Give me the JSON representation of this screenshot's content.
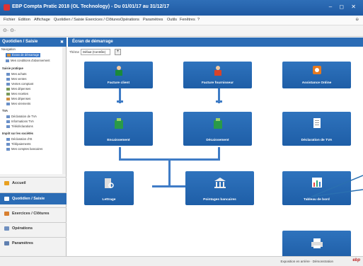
{
  "window": {
    "title": "EBP Compta Pratic 2018 (OL Technology) - Du 01/01/17 au 31/12/17",
    "controls": "– ◻ ✕"
  },
  "menu": {
    "items": [
      "Fichier",
      "Edition",
      "Affichage",
      "Quotidien / Saisie",
      "Exercices / Clôtures",
      "Opérations",
      "Paramètres",
      "Outils",
      "Fenêtres",
      "?"
    ],
    "help": "⊝"
  },
  "toolbar": {
    "nav": "⊙· ⊙·"
  },
  "left_panel": {
    "header": "Quotidien / Saisie",
    "close": "✖",
    "tree": [
      {
        "label": "Navigation",
        "type": "root"
      },
      {
        "label": "Écran de démarrage",
        "type": "selected"
      },
      {
        "label": "Mes conditions d'abonnement",
        "type": "item"
      },
      {
        "label": "Saisie pratique",
        "type": "group"
      },
      {
        "label": "Mes achats",
        "type": "item"
      },
      {
        "label": "Mes ventes",
        "type": "item"
      },
      {
        "label": "Ventes comptant",
        "type": "item"
      },
      {
        "label": "Mes dépenses",
        "type": "item"
      },
      {
        "label": "Mes recettes",
        "type": "item"
      },
      {
        "label": "Mes dépenses",
        "type": "item"
      },
      {
        "label": "Mes virements",
        "type": "item"
      },
      {
        "label": "TVA",
        "type": "group"
      },
      {
        "label": "Déclaration de TVA",
        "type": "item"
      },
      {
        "label": "Informations TVA",
        "type": "item"
      },
      {
        "label": "Télédéclarations",
        "type": "item"
      },
      {
        "label": "Impôt sur les sociétés",
        "type": "group"
      },
      {
        "label": "Déclaration d'IS",
        "type": "item"
      },
      {
        "label": "Télépaiements",
        "type": "item"
      },
      {
        "label": "Mes comptes bancaires",
        "type": "item"
      }
    ]
  },
  "bottom_nav": [
    {
      "label": "Accueil",
      "active": false,
      "color": "#e8a020"
    },
    {
      "label": "Quotidien / Saisie",
      "active": true,
      "color": "#ffffff"
    },
    {
      "label": "Exercices / Clôtures",
      "active": false,
      "color": "#d88030"
    },
    {
      "label": "Opérations",
      "active": false,
      "color": "#7090c0"
    },
    {
      "label": "Paramètres",
      "active": false,
      "color": "#6080b0"
    }
  ],
  "main": {
    "header": "Écran de démarrage",
    "theme_label": "Thème",
    "theme_value": "Défaut (Contrôle)",
    "theme_button": "+",
    "tiles": {
      "facture_client": "Facture client",
      "facture_fournisseur": "Facture fournisseur",
      "assistance": "Assistance Online",
      "encaissement": "Encaissement",
      "decaissement": "Décaissement",
      "declaration_tva": "Déclaration de TVA",
      "lettrage": "Lettrage",
      "pointages": "Pointages bancaires",
      "tableau": "Tableau de bord",
      "impression": ""
    }
  },
  "status": {
    "text": "Exposition en arrière · Démonstration",
    "logo": "ebp"
  },
  "colors": {
    "accent": "#2b6cb5",
    "tile": "#2f73bd",
    "connector": "#3f7cc6",
    "annotation": "#2a6fb0"
  }
}
